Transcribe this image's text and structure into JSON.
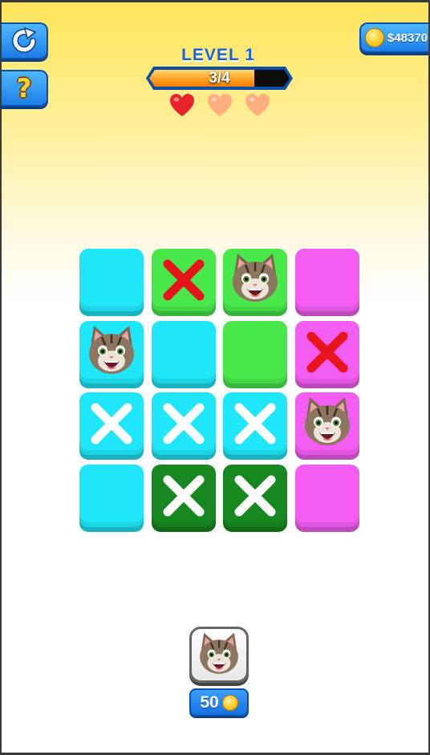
{
  "header": {
    "level_label": "LEVEL 1",
    "progress_text": "3/4",
    "progress_fraction": 0.75,
    "hearts": [
      {
        "state": "full"
      },
      {
        "state": "empty"
      },
      {
        "state": "empty"
      }
    ],
    "coins": "$48370"
  },
  "buttons": {
    "restart_icon": "restart-icon",
    "help_glyph": "?"
  },
  "colors": {
    "cyan": "#1fe6f8",
    "green": "#48e84a",
    "magenta": "#f35df2",
    "darkgreen": "#17881f",
    "red_mark": "#e8141c",
    "white_mark": "#ffffff",
    "heart_full": "#e8232e",
    "heart_empty": "#ffae7f"
  },
  "board": {
    "rows": 4,
    "cols": 4,
    "cells": [
      {
        "color": "cyan",
        "mark": "none"
      },
      {
        "color": "green",
        "mark": "red-x"
      },
      {
        "color": "green",
        "mark": "cat"
      },
      {
        "color": "magenta",
        "mark": "none"
      },
      {
        "color": "cyan",
        "mark": "cat"
      },
      {
        "color": "cyan",
        "mark": "none"
      },
      {
        "color": "green",
        "mark": "none"
      },
      {
        "color": "magenta",
        "mark": "red-x"
      },
      {
        "color": "cyan",
        "mark": "white-x"
      },
      {
        "color": "cyan",
        "mark": "white-x"
      },
      {
        "color": "cyan",
        "mark": "white-x"
      },
      {
        "color": "magenta",
        "mark": "cat"
      },
      {
        "color": "cyan",
        "mark": "none"
      },
      {
        "color": "darkgreen",
        "mark": "white-x"
      },
      {
        "color": "darkgreen",
        "mark": "white-x"
      },
      {
        "color": "magenta",
        "mark": "none"
      }
    ]
  },
  "powerup": {
    "icon": "cat-face-icon",
    "price": "50"
  }
}
